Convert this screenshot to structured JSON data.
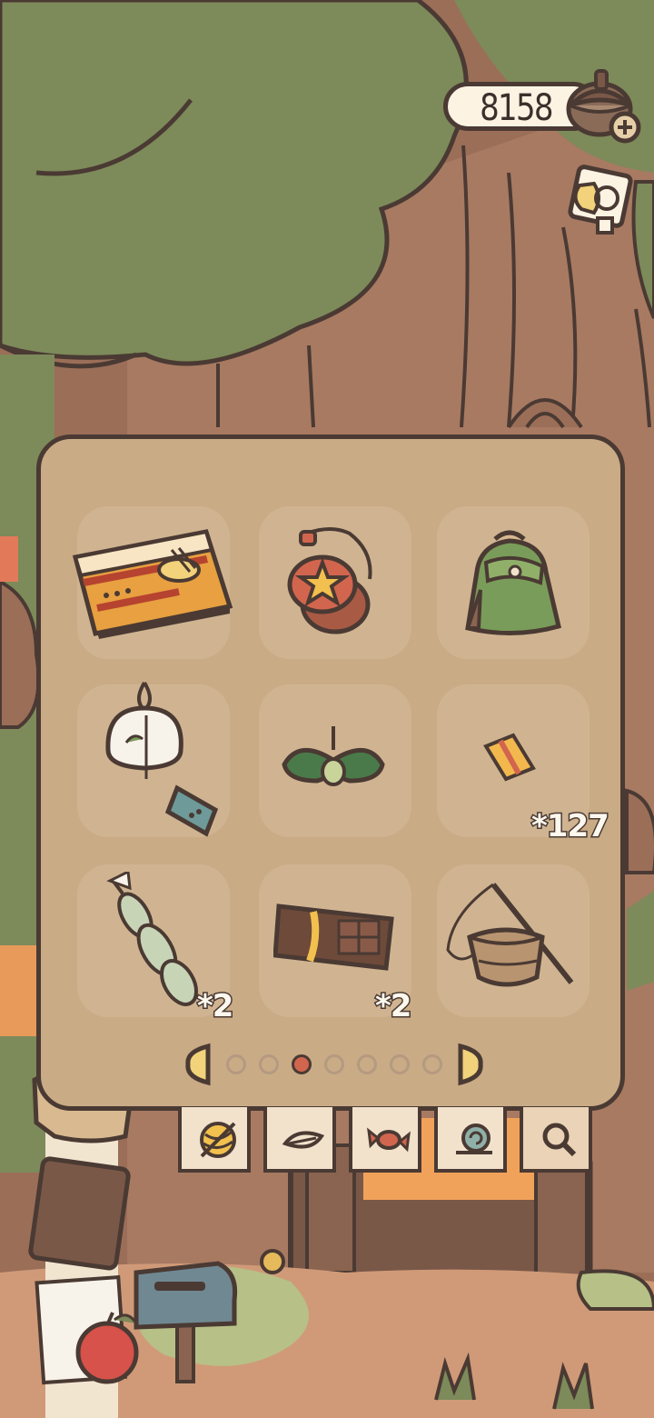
{
  "currency": {
    "label": "8158",
    "icon": "acorn-icon",
    "add_icon": "plus-icon"
  },
  "stamp_card": {
    "icon": "stamp-card-icon"
  },
  "inventory": {
    "page": 3,
    "total_pages": 7,
    "items": [
      {
        "name": "bento-box",
        "count": ""
      },
      {
        "name": "star-yoyo",
        "count": ""
      },
      {
        "name": "green-backpack",
        "count": ""
      },
      {
        "name": "wind-chime",
        "count": ""
      },
      {
        "name": "leaf-sprout",
        "count": ""
      },
      {
        "name": "ticket",
        "count": "*127"
      },
      {
        "name": "dango-skewer",
        "count": "*2"
      },
      {
        "name": "chocolate-bar",
        "count": "*2"
      },
      {
        "name": "acorn-lantern",
        "count": ""
      }
    ]
  },
  "tabs": [
    {
      "name": "yarn-tab",
      "icon": "yarn-ball-icon"
    },
    {
      "name": "leaf-tab",
      "icon": "leaf-icon"
    },
    {
      "name": "candy-tab",
      "icon": "candy-icon"
    },
    {
      "name": "snail-tab",
      "icon": "snail-icon"
    },
    {
      "name": "search-tab",
      "icon": "magnifier-icon"
    }
  ],
  "colors": {
    "panel": "#c9ab86",
    "slot": "#d0b491",
    "outline": "#4a3a33",
    "active_dot": "#d2654e",
    "foliage": "#7d8a5a"
  }
}
